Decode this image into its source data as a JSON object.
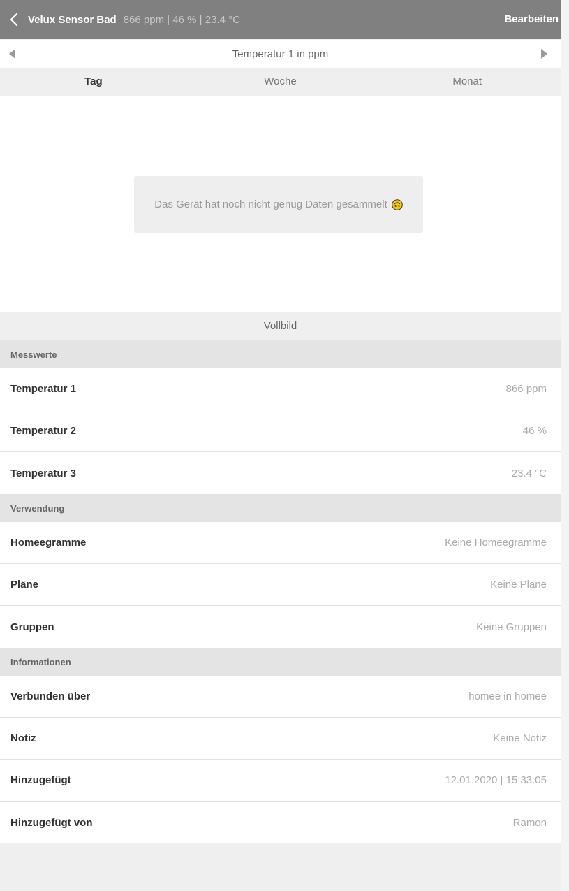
{
  "header": {
    "title": "Velux Sensor Bad",
    "subtitle": "866 ppm | 46 % | 23.4 °C",
    "edit_label": "Bearbeiten"
  },
  "chart_selector": {
    "label": "Temperatur 1 in ppm"
  },
  "tabs": [
    {
      "label": "Tag",
      "active": true
    },
    {
      "label": "Woche",
      "active": false
    },
    {
      "label": "Monat",
      "active": false
    }
  ],
  "empty_message": "Das Gerät hat noch nicht genug Daten gesammelt",
  "fullscreen_label": "Vollbild",
  "sections": {
    "measurements": {
      "title": "Messwerte",
      "rows": [
        {
          "label": "Temperatur 1",
          "value": "866 ppm"
        },
        {
          "label": "Temperatur 2",
          "value": "46 %"
        },
        {
          "label": "Temperatur 3",
          "value": "23.4 °C"
        }
      ]
    },
    "usage": {
      "title": "Verwendung",
      "rows": [
        {
          "label": "Homeegramme",
          "value": "Keine Homeegramme"
        },
        {
          "label": "Pläne",
          "value": "Keine Pläne"
        },
        {
          "label": "Gruppen",
          "value": "Keine Gruppen"
        }
      ]
    },
    "info": {
      "title": "Informationen",
      "rows": [
        {
          "label": "Verbunden über",
          "value": "homee in homee"
        },
        {
          "label": "Notiz",
          "value": "Keine Notiz"
        },
        {
          "label": "Hinzugefügt",
          "value": "12.01.2020 | 15:33:05"
        },
        {
          "label": "Hinzugefügt von",
          "value": "Ramon"
        }
      ]
    }
  },
  "colors": {
    "topbar": "#808080",
    "emoji": "#f5c518"
  }
}
